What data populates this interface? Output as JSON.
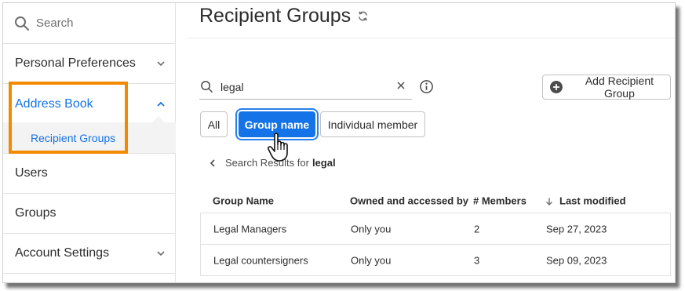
{
  "sidebar": {
    "search_label": "Search",
    "items": [
      {
        "label": "Personal Preferences"
      },
      {
        "label": "Address Book"
      },
      {
        "label": "Users"
      },
      {
        "label": "Groups"
      },
      {
        "label": "Account Settings"
      }
    ],
    "sub_items": [
      {
        "label": "Recipient Groups"
      }
    ]
  },
  "main": {
    "title": "Recipient Groups",
    "search": {
      "value": "legal",
      "placeholder": ""
    },
    "add_button_label": "Add Recipient Group",
    "filters": [
      {
        "label": "All"
      },
      {
        "label": "Group name",
        "selected": true
      },
      {
        "label": "Individual member"
      }
    ],
    "results": {
      "prefix": "Search Results for",
      "term": "legal"
    },
    "table": {
      "columns": [
        "Group Name",
        "Owned and accessed by",
        "# Members",
        "Last modified"
      ],
      "rows": [
        {
          "name": "Legal Managers",
          "owner": "Only you",
          "members": "2",
          "modified": "Sep 27, 2023"
        },
        {
          "name": "Legal countersigners",
          "owner": "Only you",
          "members": "3",
          "modified": "Sep 09, 2023"
        }
      ]
    }
  },
  "colors": {
    "accent": "#1473e6",
    "highlight": "#f28a00"
  }
}
